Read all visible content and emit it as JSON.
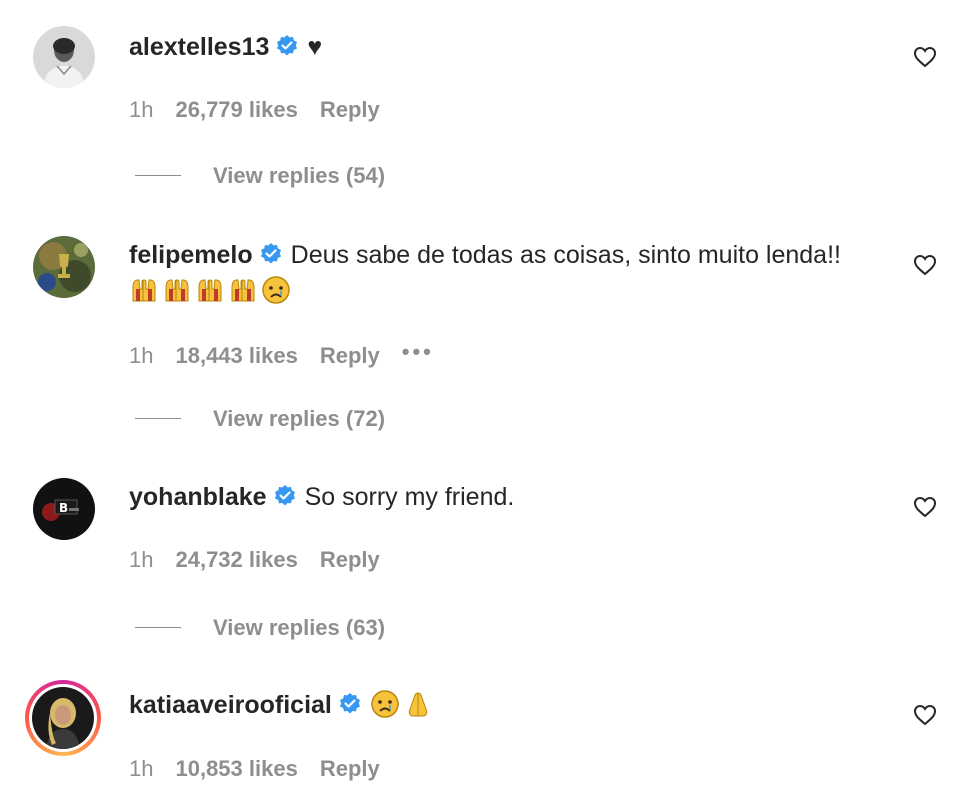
{
  "comments": [
    {
      "username": "alextelles13",
      "verified": true,
      "text": "",
      "trailing": "♥",
      "time": "1h",
      "likes": "26,779 likes",
      "reply": "Reply",
      "view_replies": "View replies (54)",
      "avatar_icon": "profile-photo-man"
    },
    {
      "username": "felipemelo",
      "verified": true,
      "text": "Deus sabe de todas as coisas, sinto muito lenda!!",
      "emojis_line2": [
        "praise-hands-emoji",
        "praise-hands-emoji",
        "praise-hands-emoji",
        "praise-hands-emoji",
        "crying-face-emoji"
      ],
      "time": "1h",
      "likes": "18,443 likes",
      "reply": "Reply",
      "more": "•••",
      "view_replies": "View replies (72)",
      "avatar_icon": "profile-photo-trophy"
    },
    {
      "username": "yohanblake",
      "verified": true,
      "text": "So sorry my friend.",
      "time": "1h",
      "likes": "24,732 likes",
      "reply": "Reply",
      "view_replies": "View replies (63)",
      "avatar_icon": "profile-photo-logo"
    },
    {
      "username": "katiaaveirooficial",
      "verified": true,
      "text": "",
      "emojis_line1": [
        "crying-face-emoji",
        "folded-hands-emoji"
      ],
      "time": "1h",
      "likes": "10,853 likes",
      "reply": "Reply",
      "avatar_icon": "profile-photo-woman",
      "story_ring": true
    }
  ],
  "colors": {
    "text": "#262626",
    "secondary": "#8e8e8e",
    "verified": "#3897f0"
  }
}
